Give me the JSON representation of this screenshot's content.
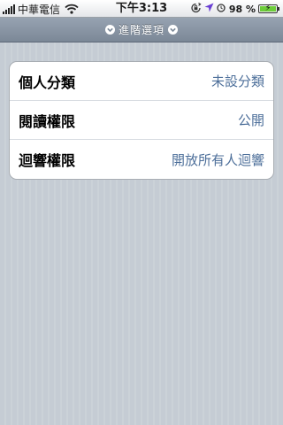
{
  "status_bar": {
    "carrier": "中華電信",
    "time": "下午3:13",
    "battery_percent": "98 %",
    "battery_level": 0.98
  },
  "header": {
    "title": "進階選項"
  },
  "settings": {
    "rows": [
      {
        "label": "個人分類",
        "value": "未設分類"
      },
      {
        "label": "閱讀權限",
        "value": "公開"
      },
      {
        "label": "迴響權限",
        "value": "開放所有人迴響"
      }
    ]
  },
  "colors": {
    "value_text": "#4d6f9a",
    "header_bg": "#8894a3",
    "background": "#c5ccd4",
    "location_arrow": "#6a3fd3",
    "battery_fill": "#6dcd3a"
  }
}
